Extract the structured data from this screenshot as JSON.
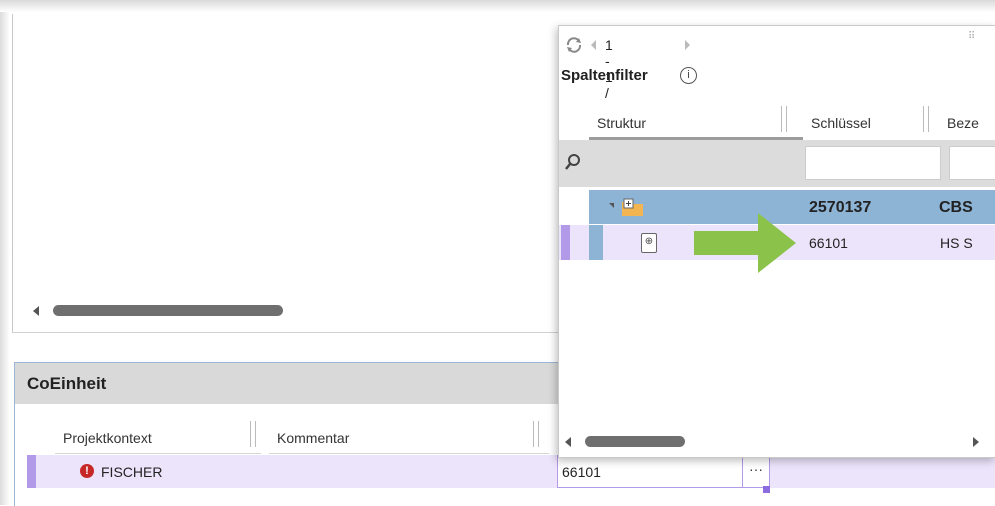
{
  "colors": {
    "accent_purple": "#b39ae8",
    "row_selected": "#ece4fb",
    "row_highlight_blue": "#8db4d5",
    "header_gray": "#d9d9d9",
    "error_red": "#c62828",
    "arrow_green": "#8bc34a"
  },
  "lower_panel": {
    "title": "CoEinheit",
    "columns": [
      "Projektkontext",
      "Kommentar"
    ],
    "row": {
      "status_icon": "error-icon",
      "projektkontext": "FISCHER",
      "value": "66101",
      "button_label": "···"
    }
  },
  "popup": {
    "toolbar": {
      "refresh_icon": "refresh-icon",
      "pager_text": "1 - 1 / 1"
    },
    "filter_title": "Spaltenfilter",
    "info_icon_glyph": "i",
    "columns": [
      "Struktur",
      "Schlüssel",
      "Beze"
    ],
    "rows": [
      {
        "key": "2570137",
        "desc": "CBS",
        "icon": "folder-icon"
      },
      {
        "key": "66101",
        "desc": "HS S",
        "icon": "document-icon"
      }
    ]
  }
}
